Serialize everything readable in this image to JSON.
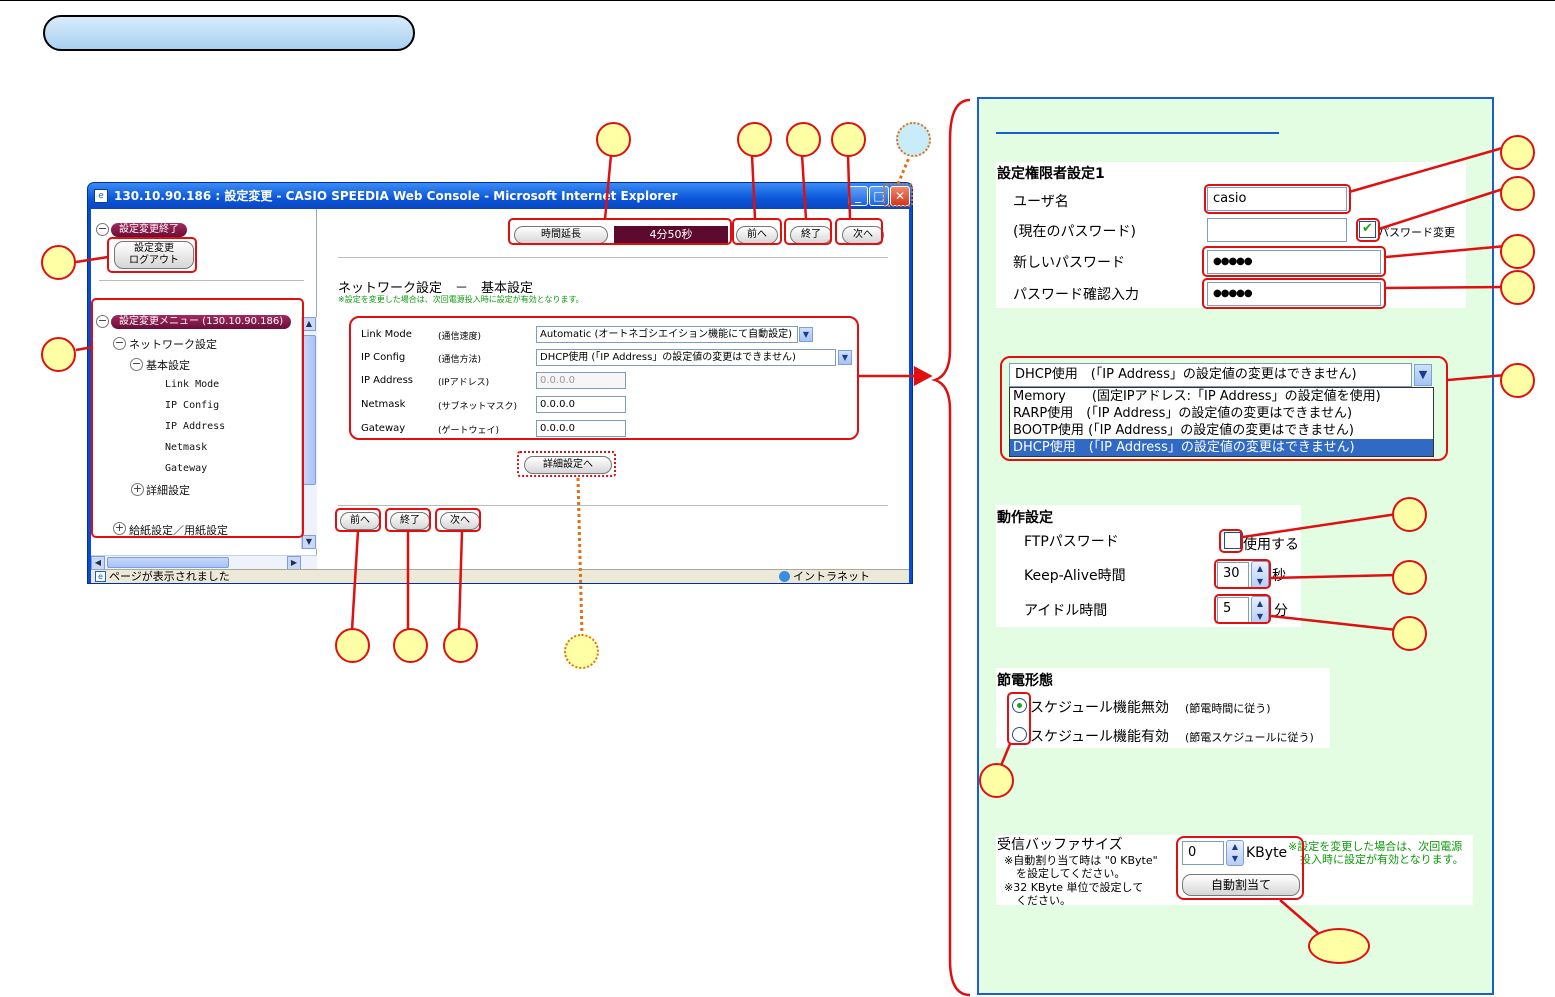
{
  "window": {
    "title": "130.10.90.186 : 設定変更 - CASIO SPEEDIA Web Console - Microsoft Internet Explorer",
    "status_text": "ページが表示されました",
    "zone_text": "イントラネット"
  },
  "left_pane": {
    "end_badge": "設定変更終了",
    "logout_button": "設定変更\nログアウト",
    "menu_badge": "設定変更メニュー (130.10.90.186)",
    "tree": [
      "ネットワーク設定",
      "基本設定",
      "Link Mode",
      "IP Config",
      "IP Address",
      "Netmask",
      "Gateway",
      "詳細設定",
      "給紙設定／用紙設定"
    ]
  },
  "main_pane": {
    "extend_button": "時間延長",
    "timer": "4分50秒",
    "prev_button": "前へ",
    "end_button": "終了",
    "next_button": "次へ",
    "heading": "ネットワーク設定　－　基本設定",
    "note": "※設定を変更した場合は、次回電源投入時に設定が有効となります。",
    "rows": [
      {
        "label": "Link Mode",
        "sub": "(通信速度)",
        "value": "Automatic (オートネゴシエイション機能にて自動設定)"
      },
      {
        "label": "IP Config",
        "sub": "(通信方法)",
        "value": "DHCP使用 (「IP Address」の設定値の変更はできません)"
      },
      {
        "label": "IP Address",
        "sub": "(IPアドレス)",
        "value": "0.0.0.0"
      },
      {
        "label": "Netmask",
        "sub": "(サブネットマスク)",
        "value": "0.0.0.0"
      },
      {
        "label": "Gateway",
        "sub": "(ゲートウェイ)",
        "value": "0.0.0.0"
      }
    ],
    "detail_button": "詳細設定へ"
  },
  "right_panel": {
    "auth_heading": "設定権限者設定1",
    "username_label": "ユーザ名",
    "username_value": "casio",
    "current_pw_label": "(現在のパスワード)",
    "current_pw_value": "",
    "change_pw_label": "パスワード変更",
    "new_pw_label": "新しいパスワード",
    "new_pw_value": "●●●●●",
    "confirm_pw_label": "パスワード確認入力",
    "confirm_pw_value": "●●●●●",
    "ip_select_value": "DHCP使用　(「IP Address」の設定値の変更はできません)",
    "ip_options": [
      "Memory　　(固定IPアドレス:「IP Address」の設定値を使用)",
      "RARP使用　(「IP Address」の設定値の変更はできません)",
      "BOOTP使用 (「IP Address」の設定値の変更はできません)",
      "DHCP使用　(「IP Address」の設定値の変更はできません)"
    ],
    "op_heading": "動作設定",
    "ftp_label": "FTPパスワード",
    "ftp_use": "使用する",
    "keepalive_label": "Keep-Alive時間",
    "keepalive_value": "30",
    "keepalive_unit": "秒",
    "idle_label": "アイドル時間",
    "idle_value": "5",
    "idle_unit": "分",
    "power_heading": "節電形態",
    "power_opt1": "スケジュール機能無効",
    "power_opt1_sub": "(節電時間に従う)",
    "power_opt2": "スケジュール機能有効",
    "power_opt2_sub": "(節電スケジュールに従う)",
    "buffer_label": "受信バッファサイズ",
    "buffer_note1": "※自動割り当て時は \"0 KByte\"",
    "buffer_note2": "を設定してください。",
    "buffer_note3": "※32 KByte 単位で設定して",
    "buffer_note4": "ください。",
    "buffer_value": "0",
    "buffer_unit": "KByte",
    "buffer_green1": "※設定を変更した場合は、次回電源",
    "buffer_green2": "投入時に設定が有効となります。",
    "auto_assign_button": "自動割当て"
  },
  "colors": {
    "callout_red": "#e01010",
    "callout_fill": "#ffffa6",
    "panel_bg": "#e3fde3",
    "panel_border": "#1a5fd0",
    "timer_bg": "#5c0a2e"
  }
}
